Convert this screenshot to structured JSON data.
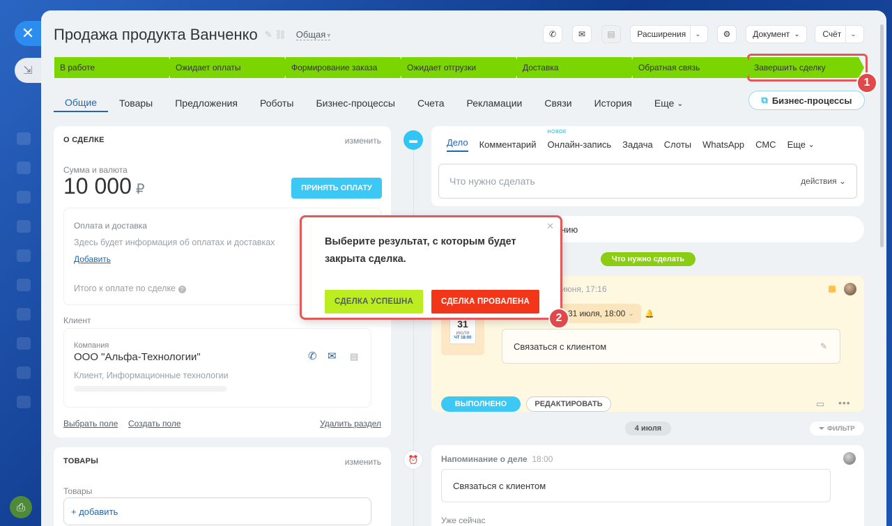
{
  "deal": {
    "title": "Продажа продукта Ванченко",
    "category": "Общая"
  },
  "toolbar": {
    "extensions": "Расширения",
    "document": "Документ",
    "invoice": "Счёт"
  },
  "stages": [
    "В работе",
    "Ожидает оплаты",
    "Формирование заказа",
    "Ожидает отгрузки",
    "Доставка",
    "Обратная связь",
    "Завершить сделку"
  ],
  "stage_color": "#7bd500",
  "tabs": [
    "Общие",
    "Товары",
    "Предложения",
    "Роботы",
    "Бизнес-процессы",
    "Счета",
    "Рекламации",
    "Связи",
    "История",
    "Еще"
  ],
  "bp_button": "Бизнес-процессы",
  "about": {
    "header": "О СДЕЛКЕ",
    "edit": "изменить",
    "sum_label": "Сумма и валюта",
    "sum": "10 000",
    "currency": "₽",
    "pay_button": "ПРИНЯТЬ ОПЛАТУ",
    "payment_title": "Оплата и доставка",
    "payment_info": "Здесь будет информация об оплатах и доставках",
    "add_link": "Добавить",
    "total_label": "Итого к оплате по сделке",
    "client_label": "Клиент",
    "company_label": "Компания",
    "company_name": "ООО \"Альфа-Технологии\"",
    "company_info": "Клиент, Информационные технологии",
    "select_field": "Выбрать поле",
    "create_field": "Создать поле",
    "delete_section": "Удалить раздел"
  },
  "products": {
    "header": "ТОВАРЫ",
    "edit": "изменить",
    "label": "Товары",
    "add": "+ добавить"
  },
  "activity": {
    "tabs": [
      "Дело",
      "Комментарий",
      "Онлайн-запись",
      "Задача",
      "Слоты",
      "WhatsApp",
      "СМС",
      "Еще"
    ],
    "new_tag": "НОВОЕ",
    "todo_placeholder": "Что нужно сделать",
    "actions": "действия",
    "hidden_text": "нию",
    "todo_pill": "Что нужно сделать",
    "task_date": "июня, 17:16",
    "deadline": "31 июля, 18:00",
    "cal_day": "31",
    "cal_month": "июля",
    "cal_time": "ЧТ 18:00",
    "task_text": "Связаться с клиентом",
    "done_button": "ВЫПОЛНЕНО",
    "edit_button": "РЕДАКТИРОВАТЬ",
    "date_pill": "4 июля",
    "filter": "ФИЛЬТР",
    "reminder_title": "Напоминание о деле",
    "reminder_time": "18:00",
    "reminder_text": "Связаться с клиентом",
    "already": "Уже сейчас"
  },
  "modal": {
    "text": "Выберите результат, с которым будет закрыта сделка.",
    "success": "СДЕЛКА УСПЕШНА",
    "fail": "СДЕЛКА ПРОВАЛЕНА",
    "success_color": "#bbed21",
    "fail_color": "#f1361a"
  },
  "badges": [
    "1",
    "2"
  ]
}
